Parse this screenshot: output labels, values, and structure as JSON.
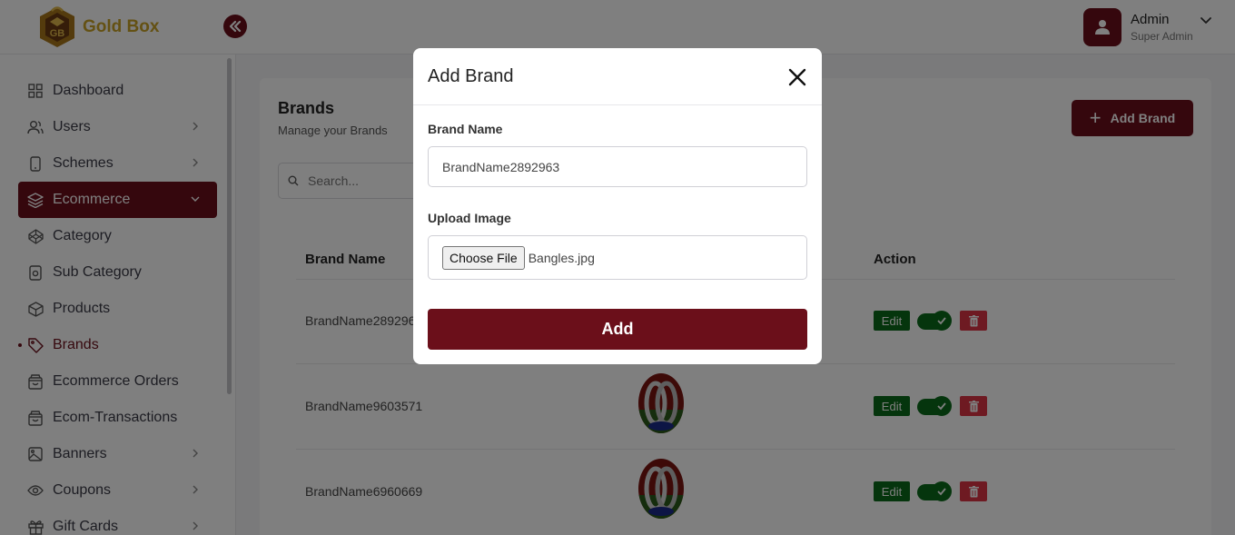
{
  "header": {
    "app_name": "Gold Box",
    "user": {
      "name": "Admin",
      "role": "Super Admin"
    }
  },
  "sidebar": {
    "items": [
      {
        "label": "Dashboard",
        "icon": "grid-icon",
        "has_submenu": false
      },
      {
        "label": "Users",
        "icon": "users-icon",
        "has_submenu": true
      },
      {
        "label": "Schemes",
        "icon": "phone-icon",
        "has_submenu": true
      },
      {
        "label": "Ecommerce",
        "icon": "layers-icon",
        "has_submenu": true,
        "active": true
      },
      {
        "label": "Category",
        "icon": "codepen-icon",
        "has_submenu": false
      },
      {
        "label": "Sub Category",
        "icon": "hard-drive-icon",
        "has_submenu": false
      },
      {
        "label": "Products",
        "icon": "box-icon",
        "has_submenu": false
      },
      {
        "label": "Brands",
        "icon": "tag-icon",
        "has_submenu": false,
        "current": true
      },
      {
        "label": "Ecommerce Orders",
        "icon": "shopping-bag-icon",
        "has_submenu": false
      },
      {
        "label": "Ecom-Transactions",
        "icon": "shopping-bag-icon",
        "has_submenu": false
      },
      {
        "label": "Banners",
        "icon": "image-icon",
        "has_submenu": true
      },
      {
        "label": "Coupons",
        "icon": "eye-icon",
        "has_submenu": true
      },
      {
        "label": "Gift Cards",
        "icon": "gift-icon",
        "has_submenu": true
      }
    ]
  },
  "page": {
    "title": "Brands",
    "subtitle": "Manage your Brands",
    "add_button_label": "Add Brand",
    "search_placeholder": "Search..."
  },
  "table": {
    "headers": {
      "brand_name": "Brand Name",
      "action": "Action"
    },
    "rows": [
      {
        "name": "BrandName2892963",
        "edit_label": "Edit",
        "enabled": true
      },
      {
        "name": "BrandName9603571",
        "edit_label": "Edit",
        "enabled": true
      },
      {
        "name": "BrandName6960669",
        "edit_label": "Edit",
        "enabled": true
      }
    ]
  },
  "modal": {
    "title": "Add Brand",
    "brand_name_label": "Brand Name",
    "brand_name_value": "BrandName2892963",
    "upload_label": "Upload Image",
    "choose_file_label": "Choose File",
    "file_name": "Bangles.jpg",
    "submit_label": "Add"
  },
  "colors": {
    "brand": "#6b0f1a",
    "gold": "#c9a227",
    "success": "#0b6b1a",
    "danger": "#dc3545"
  }
}
